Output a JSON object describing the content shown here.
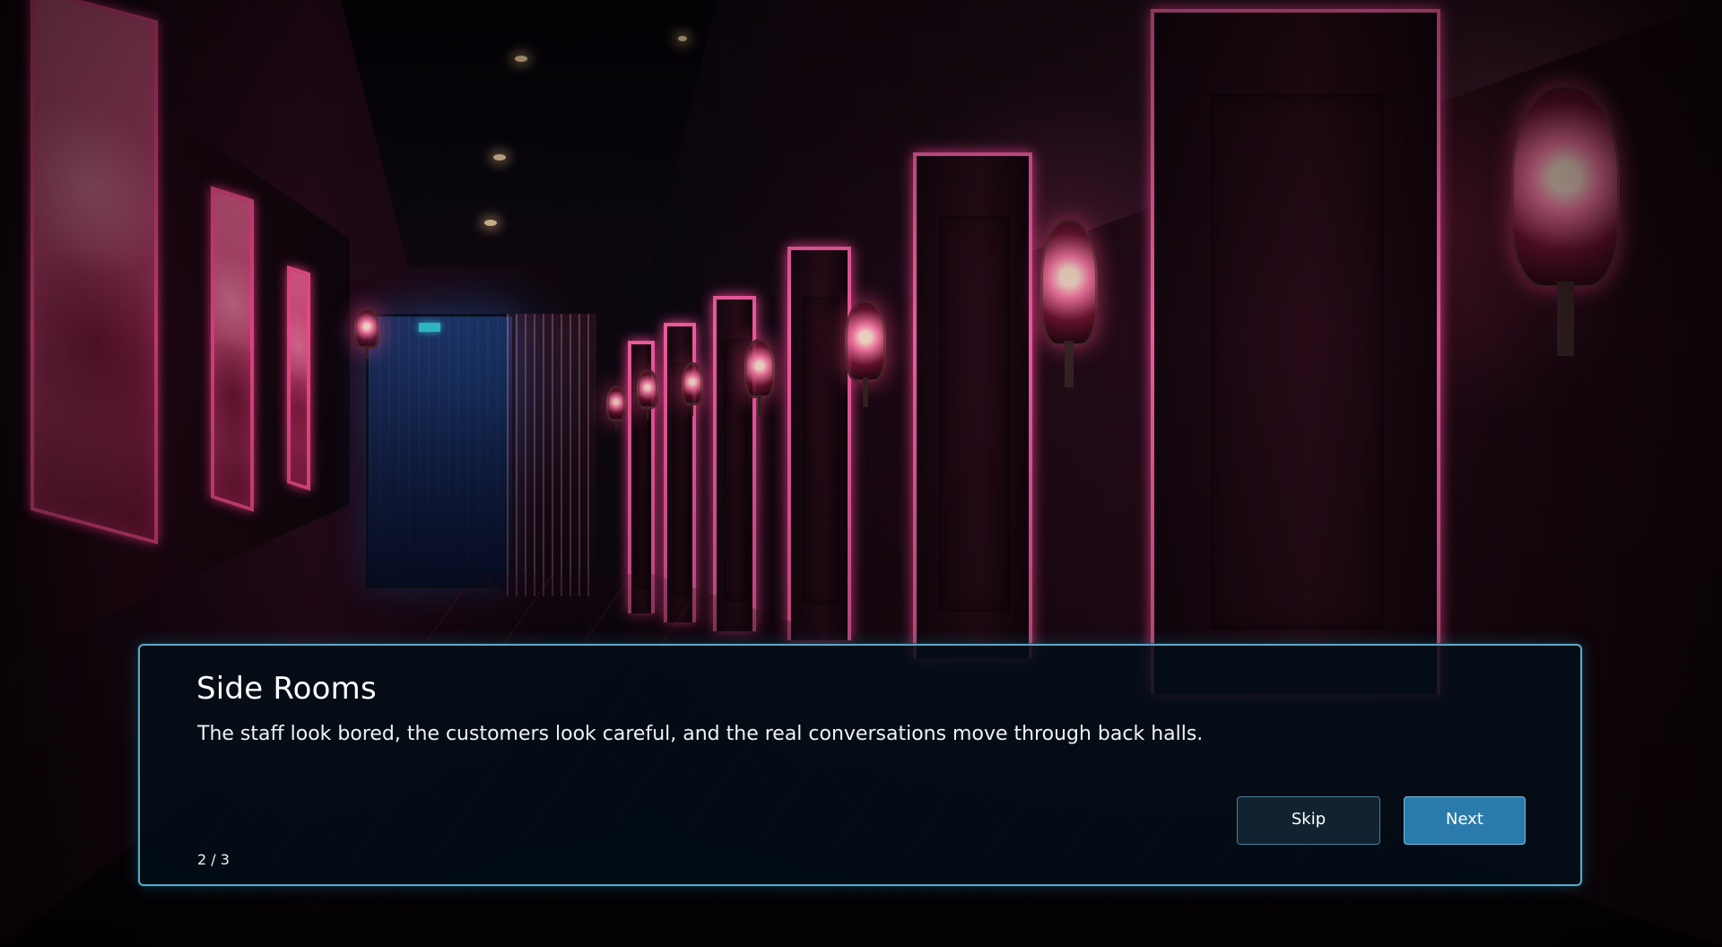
{
  "dialogue": {
    "title": "Side Rooms",
    "text": "The staff look bored, the customers look careful, and the real conversations move through back halls.",
    "progress": "2 / 3"
  },
  "buttons": {
    "skip": "Skip",
    "next": "Next"
  },
  "colors": {
    "panel_border": "#5aa8c6",
    "primary_button": "#2a7bab",
    "secondary_button": "#112331",
    "neon_accent": "#ff4f94"
  }
}
